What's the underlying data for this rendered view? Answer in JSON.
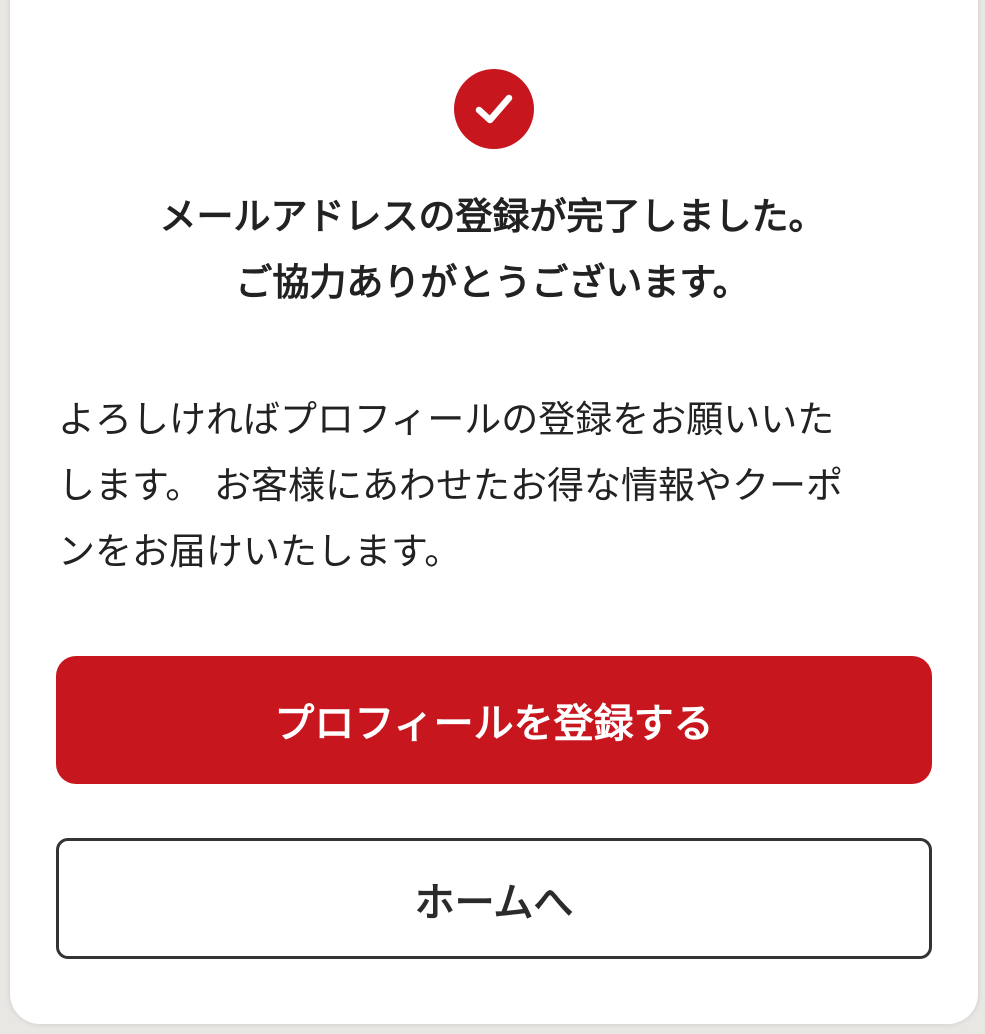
{
  "theme": {
    "accent": "#c7161e",
    "text": "#222222",
    "card": "#ffffff",
    "outline": "#333333"
  },
  "status_icon": "check-circle-icon",
  "headline": {
    "line1": "メールアドレスの登録が完了しました。",
    "line2": "ご協力ありがとうございます。"
  },
  "message": {
    "line1": "よろしければプロフィールの登録をお願いいた",
    "line2": "します。 お客様にあわせたお得な情報やクーポ",
    "line3": "ンをお届けいたします。"
  },
  "buttons": {
    "register_profile": "プロフィールを登録する",
    "home": "ホームへ"
  }
}
